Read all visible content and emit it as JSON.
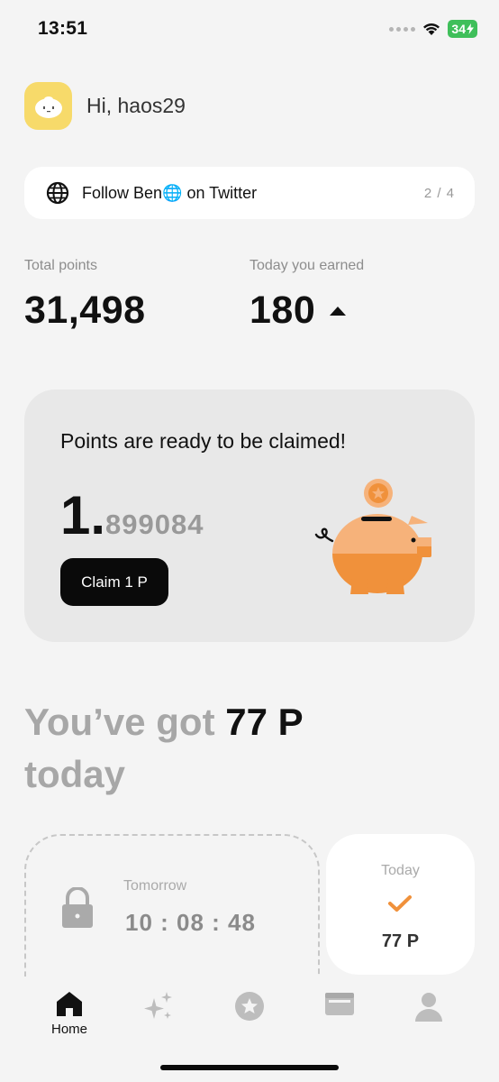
{
  "status": {
    "time": "13:51",
    "battery": "34"
  },
  "user": {
    "greeting": "Hi, haos29"
  },
  "task": {
    "label": "Follow Ben🌐 on Twitter",
    "progress": "2 / 4",
    "icon": "globe-icon"
  },
  "stats": {
    "total_label": "Total points",
    "total_value": "31,498",
    "today_label": "Today you earned",
    "today_value": "180"
  },
  "claim": {
    "title": "Points are ready to be claimed!",
    "amount_int": "1.",
    "amount_dec": "899084",
    "button": "Claim 1 P"
  },
  "summary": {
    "prefix": "You’ve got ",
    "amount": "77 P",
    "suffix": "today"
  },
  "tomorrow": {
    "label": "Tomorrow",
    "countdown": "10 : 08 : 48"
  },
  "today_card": {
    "label": "Today",
    "points": "77 P"
  },
  "tabs": [
    {
      "label": "Home",
      "icon": "home-icon",
      "active": true
    },
    {
      "label": "",
      "icon": "sparkles-icon"
    },
    {
      "label": "",
      "icon": "star-circle-icon"
    },
    {
      "label": "",
      "icon": "wallet-icon"
    },
    {
      "label": "",
      "icon": "profile-icon"
    }
  ],
  "colors": {
    "accent_orange": "#f0913b",
    "avatar_yellow": "#f7da6a",
    "battery_green": "#3fbf5a"
  }
}
